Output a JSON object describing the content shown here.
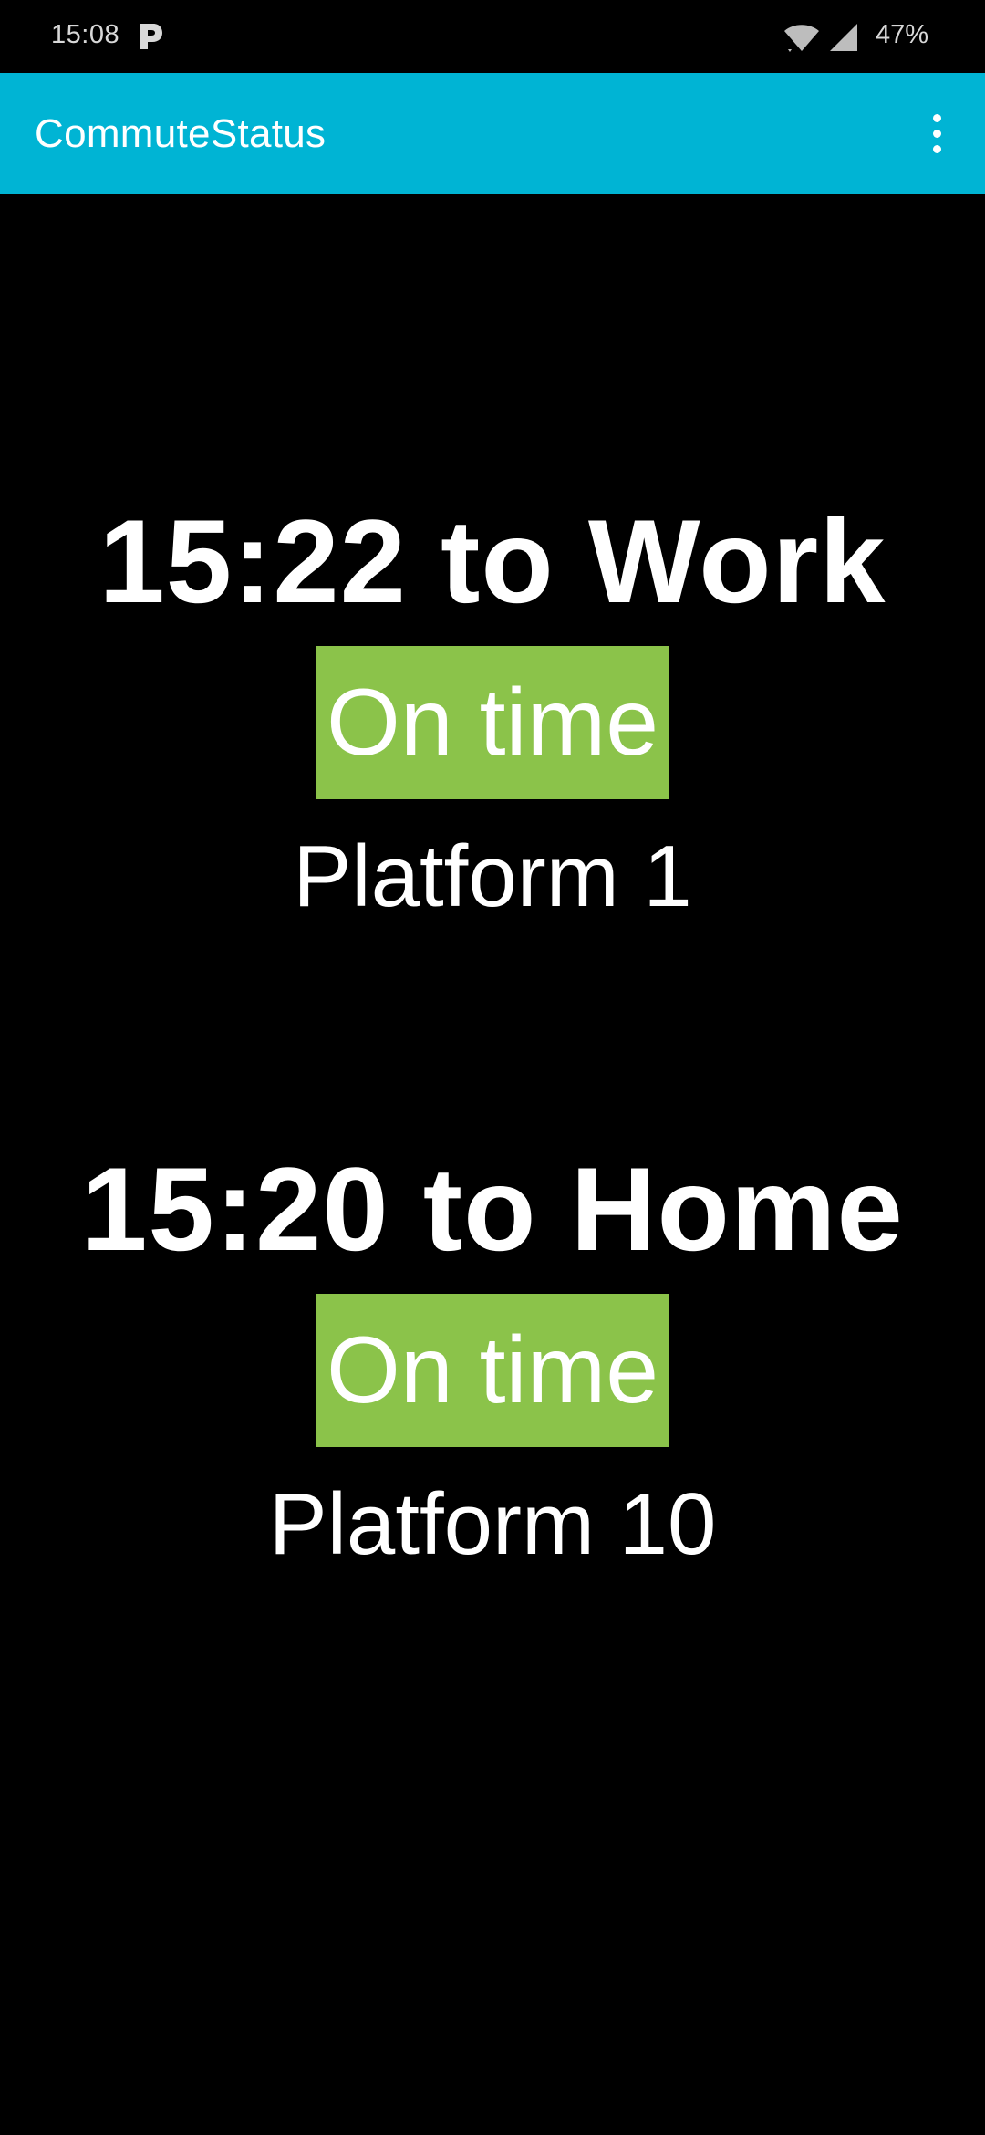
{
  "status_bar": {
    "time": "15:08",
    "battery": "47%",
    "icons": [
      "p-notification-icon",
      "wifi-icon",
      "signal-icon"
    ]
  },
  "app_bar": {
    "title": "CommuteStatus",
    "menu_icon": "overflow-menu-icon",
    "color": "#00b4d4"
  },
  "commutes": [
    {
      "title": "15:22 to Work",
      "status": "On time",
      "platform": "Platform 1"
    },
    {
      "title": "15:20 to Home",
      "status": "On time",
      "platform": "Platform 10"
    }
  ],
  "colors": {
    "on_time": "#8bc34a",
    "background": "#000000"
  }
}
